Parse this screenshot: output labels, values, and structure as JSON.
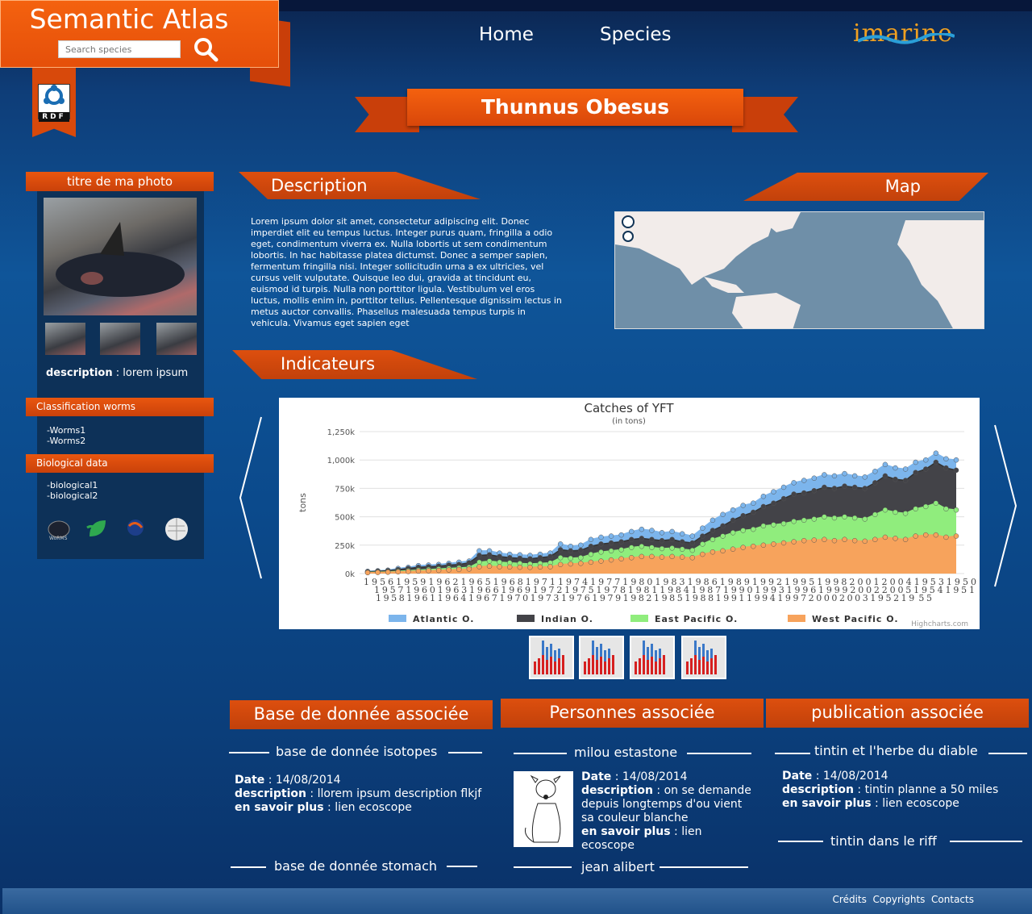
{
  "header": {
    "app_title": "Semantic Atlas",
    "search_placeholder": "Search species",
    "rdf_label": "RDF",
    "brand": "imarine"
  },
  "nav": {
    "items": [
      "Home",
      "Species"
    ]
  },
  "species_title": "Thunnus Obesus",
  "photo_panel": {
    "title": "titre de ma photo",
    "description_label": "description",
    "description_value": "lorem ipsum"
  },
  "classification": {
    "title": "Classification worms",
    "items": [
      "-Worms1",
      "-Worms2"
    ]
  },
  "biological": {
    "title": "Biological data",
    "items": [
      "-biological1",
      "-biological2"
    ]
  },
  "source_icons": [
    "worms-icon",
    "leaf-icon",
    "globe-icon",
    "wikipedia-icon"
  ],
  "description": {
    "title": "Description",
    "text": "Lorem ipsum dolor sit amet, consectetur adipiscing elit. Donec imperdiet elit eu tempus luctus. Integer purus quam, fringilla a odio eget, condimentum viverra ex. Nulla lobortis ut sem condimentum lobortis. In hac habitasse platea dictumst. Donec a semper sapien, fermentum fringilla nisi. Integer sollicitudin urna a ex ultricies, vel cursus velit vulputate. Quisque leo dui, gravida at tincidunt eu, euismod id turpis. Nulla non porttitor ligula. Vestibulum vel eros luctus, mollis enim in, porttitor tellus. Pellentesque dignissim lectus in metus auctor convallis. Phasellus malesuada tempus turpis in vehicula. Vivamus eget sapien eget"
  },
  "map": {
    "title": "Map"
  },
  "indicators": {
    "title": "Indicateurs"
  },
  "chart_data": {
    "type": "area",
    "title": "Catches of YFT",
    "subtitle": "(in tons)",
    "ylabel": "tons",
    "ylim": [
      0,
      1250000
    ],
    "yticks": [
      "0k",
      "250k",
      "500k",
      "750k",
      "1,000k",
      "1,250k"
    ],
    "credit": "Highcharts.com",
    "x_tick_rows": [
      "1956195919621965196819711974197719801983198619891992199519982001200419531950",
      "1957196019631966196919721975197819811984198719901993199619992002200519541951",
      "1958196119641967197019731976197919821985198819911994199720002003195219​55"
    ],
    "series": [
      {
        "name": "Atlantic O.",
        "color": "#7cb5ec",
        "values": [
          20,
          25,
          30,
          45,
          55,
          70,
          75,
          80,
          90,
          100,
          110,
          200,
          200,
          180,
          170,
          165,
          160,
          170,
          180,
          260,
          240,
          250,
          300,
          320,
          330,
          340,
          370,
          390,
          380,
          360,
          370,
          350,
          330,
          400,
          470,
          520,
          560,
          600,
          620,
          680,
          720,
          760,
          800,
          820,
          840,
          870,
          860,
          880,
          860,
          850,
          900,
          960,
          930,
          920,
          980,
          1000,
          1060,
          1010,
          1000
        ]
      },
      {
        "name": "Indian O.",
        "color": "#434348",
        "values": [
          15,
          20,
          25,
          35,
          45,
          55,
          60,
          65,
          75,
          80,
          95,
          160,
          165,
          150,
          140,
          135,
          130,
          140,
          150,
          210,
          200,
          205,
          240,
          260,
          270,
          280,
          300,
          310,
          300,
          290,
          300,
          280,
          270,
          330,
          380,
          420,
          470,
          510,
          540,
          590,
          620,
          660,
          700,
          710,
          730,
          760,
          750,
          770,
          760,
          750,
          800,
          860,
          830,
          820,
          890,
          920,
          980,
          930,
          910
        ]
      },
      {
        "name": "East Pacific O.",
        "color": "#90ed7d",
        "values": [
          10,
          12,
          15,
          20,
          25,
          30,
          35,
          40,
          45,
          50,
          55,
          100,
          110,
          100,
          95,
          90,
          85,
          90,
          95,
          140,
          135,
          140,
          170,
          190,
          200,
          210,
          230,
          240,
          230,
          220,
          225,
          215,
          205,
          260,
          300,
          330,
          360,
          380,
          390,
          420,
          430,
          440,
          460,
          470,
          480,
          500,
          490,
          500,
          490,
          480,
          520,
          560,
          540,
          530,
          570,
          590,
          620,
          570,
          560
        ]
      },
      {
        "name": "West Pacific O.",
        "color": "#f7a35c",
        "values": [
          8,
          10,
          12,
          15,
          18,
          22,
          25,
          28,
          32,
          36,
          40,
          60,
          65,
          60,
          58,
          56,
          55,
          58,
          60,
          80,
          85,
          90,
          100,
          110,
          120,
          130,
          140,
          150,
          150,
          145,
          150,
          145,
          140,
          170,
          190,
          200,
          215,
          230,
          240,
          250,
          260,
          270,
          280,
          290,
          295,
          300,
          290,
          300,
          290,
          285,
          300,
          320,
          310,
          300,
          330,
          340,
          340,
          320,
          330
        ]
      }
    ]
  },
  "thumb_count": 4,
  "databases": {
    "title": "Base de donnée associée",
    "items": [
      {
        "name": "base de donnée isotopes",
        "date_label": "Date",
        "date": "14/08/2014",
        "description_label": "description",
        "description": "llorem ipsum description flkjf",
        "more_label": "en savoir plus",
        "more": "lien ecoscope"
      },
      {
        "name": "base de donnée stomach"
      }
    ]
  },
  "people": {
    "title": "Personnes associée",
    "items": [
      {
        "name": "milou estastone",
        "date_label": "Date",
        "date": "14/08/2014",
        "description_label": "description",
        "description": "on se demande depuis longtemps d'ou vient sa couleur blanche",
        "more_label": "en savoir plus",
        "more": "lien ecoscope"
      },
      {
        "name": "jean alibert"
      }
    ]
  },
  "publications": {
    "title": "publication associée",
    "items": [
      {
        "name": "tintin et l'herbe du diable",
        "date_label": "Date",
        "date": "14/08/2014",
        "description_label": "description",
        "description": "tintin planne a 50 miles",
        "more_label": "en savoir plus",
        "more": "lien ecoscope"
      },
      {
        "name": "tintin dans le riff"
      }
    ]
  },
  "footer": {
    "links": [
      "Crédits",
      "Copyrights",
      "Contacts"
    ]
  }
}
